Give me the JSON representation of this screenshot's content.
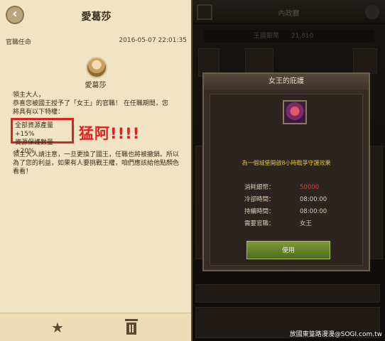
{
  "letter": {
    "title": "愛葛莎",
    "type": "官職任命",
    "date": "2016-05-07  22:01:35",
    "sender": "愛葛莎",
    "greeting": "領主大人，",
    "line1": "恭喜您被國王授予了「女王」的官職！ 在任職期間，您",
    "line2": "將具有以下特權：",
    "perk1": "全部資源產量+15%",
    "perk2": "資源保護數量+20%",
    "annotation": "猛阿!!!!",
    "para2": "領主大人請注意，一旦更換了國王，任職也將被撤銷。所以為了您的利益，如果有人要挑戰王權，咱們應該給他點顏色看看！"
  },
  "game": {
    "header_title": "內政廳",
    "silver_label": "王國銀幣",
    "silver_value": "21,810"
  },
  "dialog": {
    "title": "女王的庇護",
    "description": "為一個城堡開啟8小時戰爭守護效果",
    "rows": [
      {
        "k": "消耗銀幣：",
        "v": "50000"
      },
      {
        "k": "冷卻時間：",
        "v": "08:00:00"
      },
      {
        "k": "持續時間：",
        "v": "08:00:00"
      },
      {
        "k": "需要官職：",
        "v": "女王"
      }
    ],
    "use_label": "使用"
  },
  "watermark": "放國東篁路漫漫@SOGI.com.tw",
  "colors": {
    "letter_bg": "#f1e4c4",
    "annotation_red": "#e02020",
    "cost_red": "#e43a2a",
    "desc_yellow": "#e0c13a",
    "button_green": "#6b8a2e"
  }
}
